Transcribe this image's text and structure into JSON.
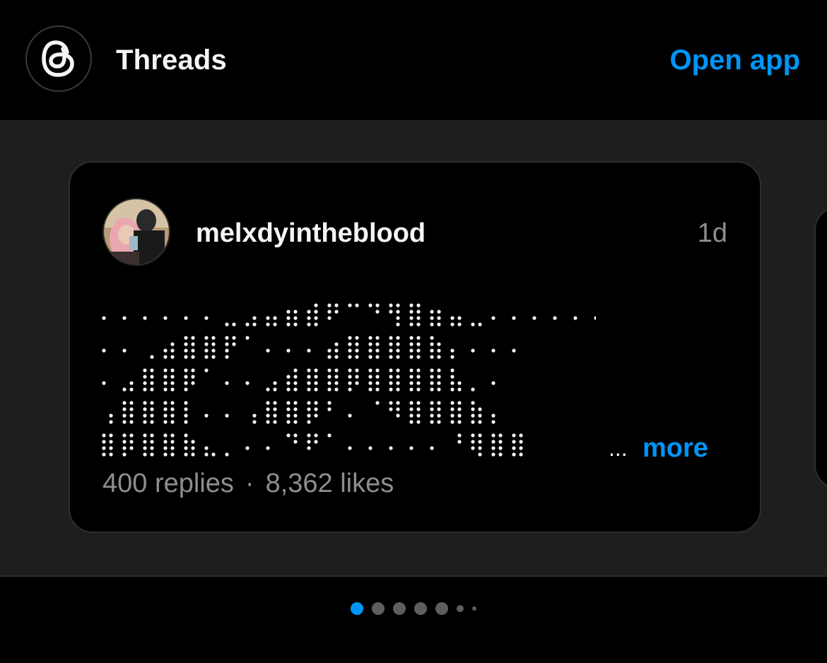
{
  "header": {
    "app_name": "Threads",
    "open_app_label": "Open app",
    "logo_icon": "threads-logo-icon"
  },
  "post": {
    "username": "melxdyintheblood",
    "time_ago": "1d",
    "content_braille_lines": [
      "⠄⠄⠄⠄⠄⠄⣀⣠⣤⣶⣾⠟⠉⠙⢻⣿⣶⣤⣀⠄⠄⠄⠄⠄⠄",
      "⠄⠄⢀⣴⣿⣿⡟⠁⠄⠄⠄⣴⣿⣿⣿⣿⣷⡄⠄⠄⠄",
      "⠄⣠⣿⣿⡿⠁⠄⠄⣠⣾⣿⣿⡿⣿⣿⣿⣿⣧⡀⠄",
      "⢠⣿⣿⣿⡇⠄⠄⢠⣿⣿⡿⠃⠄⠈⠻⣿⣿⣿⣷⡄",
      "⣿⡿⣿⣿⣷⣄⡀⠄⠄⠙⠟⠁⠄⠄⠄⠄⠄⠘⢿⣿⣿"
    ],
    "more_label": "more",
    "ellipsis": "...",
    "replies": "400 replies",
    "separator": "·",
    "likes": "8,362 likes"
  },
  "pagination": {
    "active_index": 0,
    "dot_count": 7
  },
  "colors": {
    "accent": "#0095f6",
    "background": "#000000",
    "carousel_bg": "#1e1e1e",
    "muted_text": "#8e8e8e"
  }
}
